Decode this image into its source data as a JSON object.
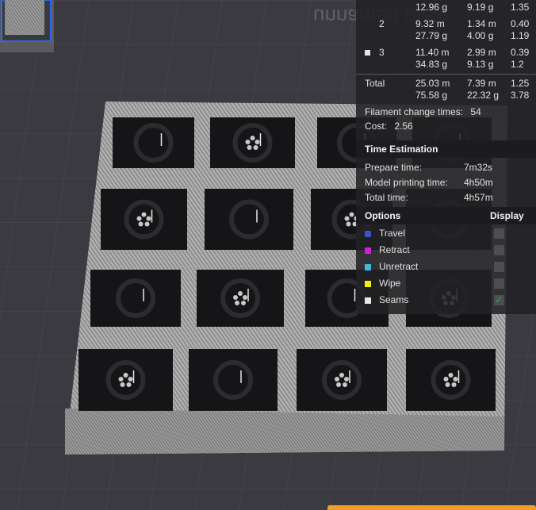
{
  "plate_label": "unnamed plate",
  "filament_rows": [
    {
      "id": "",
      "color": "",
      "m": "",
      "a": "",
      "b": "",
      "c": "",
      "g_a": "12.96 g",
      "g_b": "9.19 g",
      "g_c": "1.35"
    },
    {
      "id": "2",
      "color": "",
      "a": "9.32 m",
      "b": "1.34 m",
      "c": "0.40",
      "g_a": "27.79 g",
      "g_b": "4.00 g",
      "g_c": "1.19"
    },
    {
      "id": "3",
      "color": "#e6e6e6",
      "a": "11.40 m",
      "b": "2.99 m",
      "c": "0.39",
      "g_a": "34.83 g",
      "g_b": "9.13 g",
      "g_c": "1.2"
    },
    {
      "id": "Total",
      "color": "",
      "a": "25.03 m",
      "b": "7.39 m",
      "c": "1.25",
      "g_a": "75.58 g",
      "g_b": "22.32 g",
      "g_c": "3.78"
    }
  ],
  "filament_change": {
    "label": "Filament change times:",
    "value": "54"
  },
  "cost": {
    "label": "Cost:",
    "value": "2.56"
  },
  "time_estimation": {
    "title": "Time Estimation",
    "items": [
      {
        "label": "Prepare time:",
        "value": "7m32s"
      },
      {
        "label": "Model printing time:",
        "value": "4h50m"
      },
      {
        "label": "Total time:",
        "value": "4h57m"
      }
    ]
  },
  "options": {
    "title": "Options",
    "display_label": "Display",
    "items": [
      {
        "label": "Travel",
        "color": "#3a54c8",
        "checked": false
      },
      {
        "label": "Retract",
        "color": "#d020d8",
        "checked": false
      },
      {
        "label": "Unretract",
        "color": "#40b8e0",
        "checked": false
      },
      {
        "label": "Wipe",
        "color": "#f0f000",
        "checked": false
      },
      {
        "label": "Seams",
        "color": "#e8e8e8",
        "checked": true
      }
    ]
  },
  "icons": {
    "check": "check-icon"
  }
}
